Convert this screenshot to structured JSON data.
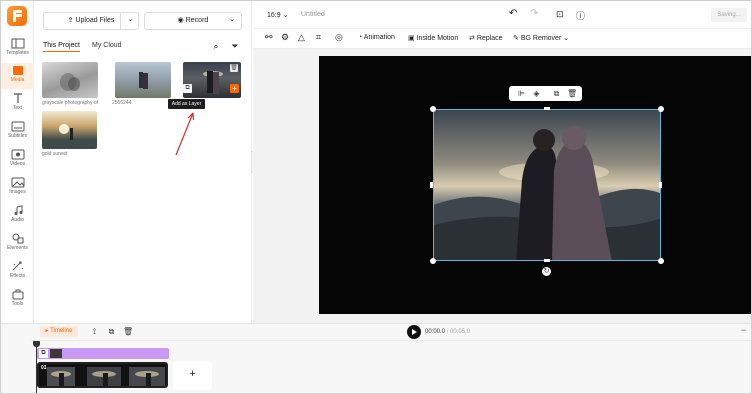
{
  "rail": {
    "items": [
      {
        "label": "Templates",
        "icon": "templates-icon"
      },
      {
        "label": "Media",
        "icon": "media-icon"
      },
      {
        "label": "Text",
        "icon": "text-icon"
      },
      {
        "label": "Subtitles",
        "icon": "subtitles-icon"
      },
      {
        "label": "Videos",
        "icon": "videos-icon"
      },
      {
        "label": "Images",
        "icon": "images-icon"
      },
      {
        "label": "Audio",
        "icon": "audio-icon"
      },
      {
        "label": "Elements",
        "icon": "elements-icon"
      },
      {
        "label": "Effects",
        "icon": "effects-icon"
      },
      {
        "label": "Tools",
        "icon": "tools-icon"
      }
    ],
    "active": "Media"
  },
  "panel": {
    "upload_label": "Upload Files",
    "record_label": "Record",
    "tabs": [
      "This Project",
      "My Cloud"
    ],
    "media": [
      {
        "caption": "grayscale photography of"
      },
      {
        "caption": "2566244"
      },
      {
        "caption": ""
      },
      {
        "caption": "gold sunset"
      }
    ],
    "tooltip": "Add as Layer"
  },
  "topbar": {
    "ratio": "16:9",
    "title": "Untitled",
    "saving": "Saving..."
  },
  "toolbar": {
    "animation": "Animation",
    "inside_motion": "Inside Motion",
    "replace": "Replace",
    "bg_remover": "BG Remover"
  },
  "timeline": {
    "label": "Timeline",
    "current_time": "00:00.0",
    "total_time": "00:05.0",
    "clip_number": "01",
    "add_label": "+"
  },
  "colors": {
    "accent": "#ff6a00",
    "layer_track": "#c99af5",
    "selection": "#5fb7d9"
  }
}
